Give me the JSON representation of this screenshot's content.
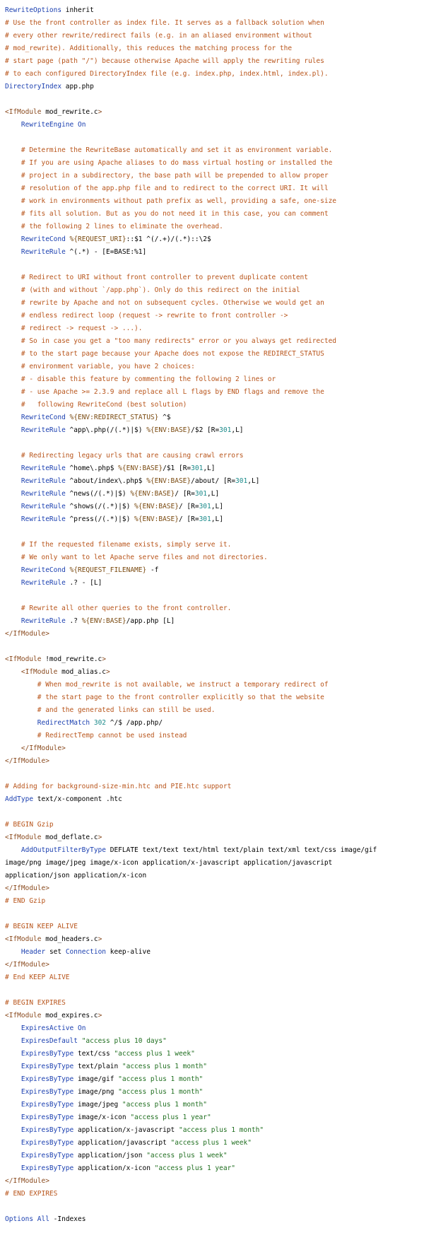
{
  "lines": [
    [
      [
        "k",
        "RewriteOptions"
      ],
      [
        "p",
        " inherit"
      ]
    ],
    [
      [
        "c",
        "# Use the front controller as index file. It serves as a fallback solution when"
      ]
    ],
    [
      [
        "c",
        "# every other rewrite/redirect fails (e.g. in an aliased environment without"
      ]
    ],
    [
      [
        "c",
        "# mod_rewrite). Additionally, this reduces the matching process for the"
      ]
    ],
    [
      [
        "c",
        "# start page (path \"/\") because otherwise Apache will apply the rewriting rules"
      ]
    ],
    [
      [
        "c",
        "# to each configured DirectoryIndex file (e.g. index.php, index.html, index.pl)."
      ]
    ],
    [
      [
        "k",
        "DirectoryIndex"
      ],
      [
        "p",
        " app.php"
      ]
    ],
    [],
    [
      [
        "t",
        "<IfModule"
      ],
      [
        "p",
        " mod_rewrite.c"
      ],
      [
        "t",
        ">"
      ]
    ],
    [
      [
        "p",
        "    "
      ],
      [
        "k",
        "RewriteEngine"
      ],
      [
        "p",
        " "
      ],
      [
        "k",
        "On"
      ]
    ],
    [],
    [
      [
        "p",
        "    "
      ],
      [
        "c",
        "# Determine the RewriteBase automatically and set it as environment variable."
      ]
    ],
    [
      [
        "p",
        "    "
      ],
      [
        "c",
        "# If you are using Apache aliases to do mass virtual hosting or installed the"
      ]
    ],
    [
      [
        "p",
        "    "
      ],
      [
        "c",
        "# project in a subdirectory, the base path will be prepended to allow proper"
      ]
    ],
    [
      [
        "p",
        "    "
      ],
      [
        "c",
        "# resolution of the app.php file and to redirect to the correct URI. It will"
      ]
    ],
    [
      [
        "p",
        "    "
      ],
      [
        "c",
        "# work in environments without path prefix as well, providing a safe, one-size"
      ]
    ],
    [
      [
        "p",
        "    "
      ],
      [
        "c",
        "# fits all solution. But as you do not need it in this case, you can comment"
      ]
    ],
    [
      [
        "p",
        "    "
      ],
      [
        "c",
        "# the following 2 lines to eliminate the overhead."
      ]
    ],
    [
      [
        "p",
        "    "
      ],
      [
        "k",
        "RewriteCond"
      ],
      [
        "p",
        " "
      ],
      [
        "v",
        "%{REQUEST_URI}"
      ],
      [
        "p",
        "::$1 ^(/.+)/(.*)::\\2$"
      ]
    ],
    [
      [
        "p",
        "    "
      ],
      [
        "k",
        "RewriteRule"
      ],
      [
        "p",
        " ^(.*) - [E=BASE:%1]"
      ]
    ],
    [],
    [
      [
        "p",
        "    "
      ],
      [
        "c",
        "# Redirect to URI without front controller to prevent duplicate content"
      ]
    ],
    [
      [
        "p",
        "    "
      ],
      [
        "c",
        "# (with and without `/app.php`). Only do this redirect on the initial"
      ]
    ],
    [
      [
        "p",
        "    "
      ],
      [
        "c",
        "# rewrite by Apache and not on subsequent cycles. Otherwise we would get an"
      ]
    ],
    [
      [
        "p",
        "    "
      ],
      [
        "c",
        "# endless redirect loop (request -> rewrite to front controller ->"
      ]
    ],
    [
      [
        "p",
        "    "
      ],
      [
        "c",
        "# redirect -> request -> ...)."
      ]
    ],
    [
      [
        "p",
        "    "
      ],
      [
        "c",
        "# So in case you get a \"too many redirects\" error or you always get redirected"
      ]
    ],
    [
      [
        "p",
        "    "
      ],
      [
        "c",
        "# to the start page because your Apache does not expose the REDIRECT_STATUS"
      ]
    ],
    [
      [
        "p",
        "    "
      ],
      [
        "c",
        "# environment variable, you have 2 choices:"
      ]
    ],
    [
      [
        "p",
        "    "
      ],
      [
        "c",
        "# - disable this feature by commenting the following 2 lines or"
      ]
    ],
    [
      [
        "p",
        "    "
      ],
      [
        "c",
        "# - use Apache >= 2.3.9 and replace all L flags by END flags and remove the"
      ]
    ],
    [
      [
        "p",
        "    "
      ],
      [
        "c",
        "#   following RewriteCond (best solution)"
      ]
    ],
    [
      [
        "p",
        "    "
      ],
      [
        "k",
        "RewriteCond"
      ],
      [
        "p",
        " "
      ],
      [
        "v",
        "%{ENV:REDIRECT_STATUS}"
      ],
      [
        "p",
        " ^$"
      ]
    ],
    [
      [
        "p",
        "    "
      ],
      [
        "k",
        "RewriteRule"
      ],
      [
        "p",
        " ^app\\.php(/(.*)|$) "
      ],
      [
        "v",
        "%{ENV:BASE}"
      ],
      [
        "p",
        "/$2 [R="
      ],
      [
        "n",
        "301"
      ],
      [
        "p",
        ",L]"
      ]
    ],
    [],
    [
      [
        "p",
        "    "
      ],
      [
        "c",
        "# Redirecting legacy urls that are causing crawl errors"
      ]
    ],
    [
      [
        "p",
        "    "
      ],
      [
        "k",
        "RewriteRule"
      ],
      [
        "p",
        " ^home\\.php$ "
      ],
      [
        "v",
        "%{ENV:BASE}"
      ],
      [
        "p",
        "/$1 [R="
      ],
      [
        "n",
        "301"
      ],
      [
        "p",
        ",L]"
      ]
    ],
    [
      [
        "p",
        "    "
      ],
      [
        "k",
        "RewriteRule"
      ],
      [
        "p",
        " ^about/index\\.php$ "
      ],
      [
        "v",
        "%{ENV:BASE}"
      ],
      [
        "p",
        "/about/ [R="
      ],
      [
        "n",
        "301"
      ],
      [
        "p",
        ",L]"
      ]
    ],
    [
      [
        "p",
        "    "
      ],
      [
        "k",
        "RewriteRule"
      ],
      [
        "p",
        " ^news(/(.*)|$) "
      ],
      [
        "v",
        "%{ENV:BASE}"
      ],
      [
        "p",
        "/ [R="
      ],
      [
        "n",
        "301"
      ],
      [
        "p",
        ",L]"
      ]
    ],
    [
      [
        "p",
        "    "
      ],
      [
        "k",
        "RewriteRule"
      ],
      [
        "p",
        " ^shows(/(.*)|$) "
      ],
      [
        "v",
        "%{ENV:BASE}"
      ],
      [
        "p",
        "/ [R="
      ],
      [
        "n",
        "301"
      ],
      [
        "p",
        ",L]"
      ]
    ],
    [
      [
        "p",
        "    "
      ],
      [
        "k",
        "RewriteRule"
      ],
      [
        "p",
        " ^press(/(.*)|$) "
      ],
      [
        "v",
        "%{ENV:BASE}"
      ],
      [
        "p",
        "/ [R="
      ],
      [
        "n",
        "301"
      ],
      [
        "p",
        ",L]"
      ]
    ],
    [],
    [
      [
        "p",
        "    "
      ],
      [
        "c",
        "# If the requested filename exists, simply serve it."
      ]
    ],
    [
      [
        "p",
        "    "
      ],
      [
        "c",
        "# We only want to let Apache serve files and not directories."
      ]
    ],
    [
      [
        "p",
        "    "
      ],
      [
        "k",
        "RewriteCond"
      ],
      [
        "p",
        " "
      ],
      [
        "v",
        "%{REQUEST_FILENAME}"
      ],
      [
        "p",
        " -f"
      ]
    ],
    [
      [
        "p",
        "    "
      ],
      [
        "k",
        "RewriteRule"
      ],
      [
        "p",
        " .? - [L]"
      ]
    ],
    [],
    [
      [
        "p",
        "    "
      ],
      [
        "c",
        "# Rewrite all other queries to the front controller."
      ]
    ],
    [
      [
        "p",
        "    "
      ],
      [
        "k",
        "RewriteRule"
      ],
      [
        "p",
        " .? "
      ],
      [
        "v",
        "%{ENV:BASE}"
      ],
      [
        "p",
        "/app.php [L]"
      ]
    ],
    [
      [
        "t",
        "</IfModule>"
      ]
    ],
    [],
    [
      [
        "t",
        "<IfModule"
      ],
      [
        "p",
        " !mod_rewrite.c"
      ],
      [
        "t",
        ">"
      ]
    ],
    [
      [
        "p",
        "    "
      ],
      [
        "t",
        "<IfModule"
      ],
      [
        "p",
        " mod_alias.c"
      ],
      [
        "t",
        ">"
      ]
    ],
    [
      [
        "p",
        "        "
      ],
      [
        "c",
        "# When mod_rewrite is not available, we instruct a temporary redirect of"
      ]
    ],
    [
      [
        "p",
        "        "
      ],
      [
        "c",
        "# the start page to the front controller explicitly so that the website"
      ]
    ],
    [
      [
        "p",
        "        "
      ],
      [
        "c",
        "# and the generated links can still be used."
      ]
    ],
    [
      [
        "p",
        "        "
      ],
      [
        "k",
        "RedirectMatch"
      ],
      [
        "p",
        " "
      ],
      [
        "n",
        "302"
      ],
      [
        "p",
        " ^/$ /app.php/"
      ]
    ],
    [
      [
        "p",
        "        "
      ],
      [
        "c",
        "# RedirectTemp cannot be used instead"
      ]
    ],
    [
      [
        "p",
        "    "
      ],
      [
        "t",
        "</IfModule>"
      ]
    ],
    [
      [
        "t",
        "</IfModule>"
      ]
    ],
    [],
    [
      [
        "c",
        "# Adding for background-size-min.htc and PIE.htc support"
      ]
    ],
    [
      [
        "k",
        "AddType"
      ],
      [
        "p",
        " text/x-component .htc"
      ]
    ],
    [],
    [
      [
        "c",
        "# BEGIN Gzip"
      ]
    ],
    [
      [
        "t",
        "<IfModule"
      ],
      [
        "p",
        " mod_deflate.c"
      ],
      [
        "t",
        ">"
      ]
    ],
    [
      [
        "p",
        "    "
      ],
      [
        "k",
        "AddOutputFilterByType"
      ],
      [
        "p",
        " DEFLATE text/text text/html text/plain text/xml text/css image/gif"
      ]
    ],
    [
      [
        "p",
        "image/png image/jpeg image/x-icon application/x-javascript application/javascript"
      ]
    ],
    [
      [
        "p",
        "application/json application/x-icon"
      ]
    ],
    [
      [
        "t",
        "</IfModule>"
      ]
    ],
    [
      [
        "c",
        "# END Gzip"
      ]
    ],
    [],
    [
      [
        "c",
        "# BEGIN KEEP ALIVE"
      ]
    ],
    [
      [
        "t",
        "<IfModule"
      ],
      [
        "p",
        " mod_headers.c"
      ],
      [
        "t",
        ">"
      ]
    ],
    [
      [
        "p",
        "    "
      ],
      [
        "k",
        "Header"
      ],
      [
        "p",
        " set "
      ],
      [
        "k",
        "Connection"
      ],
      [
        "p",
        " keep-alive"
      ]
    ],
    [
      [
        "t",
        "</IfModule>"
      ]
    ],
    [
      [
        "c",
        "# End KEEP ALIVE"
      ]
    ],
    [],
    [
      [
        "c",
        "# BEGIN EXPIRES"
      ]
    ],
    [
      [
        "t",
        "<IfModule"
      ],
      [
        "p",
        " mod_expires.c"
      ],
      [
        "t",
        ">"
      ]
    ],
    [
      [
        "p",
        "    "
      ],
      [
        "k",
        "ExpiresActive"
      ],
      [
        "p",
        " "
      ],
      [
        "k",
        "On"
      ]
    ],
    [
      [
        "p",
        "    "
      ],
      [
        "k",
        "ExpiresDefault"
      ],
      [
        "p",
        " "
      ],
      [
        "s",
        "\"access plus 10 days\""
      ]
    ],
    [
      [
        "p",
        "    "
      ],
      [
        "k",
        "ExpiresByType"
      ],
      [
        "p",
        " text/css "
      ],
      [
        "s",
        "\"access plus 1 week\""
      ]
    ],
    [
      [
        "p",
        "    "
      ],
      [
        "k",
        "ExpiresByType"
      ],
      [
        "p",
        " text/plain "
      ],
      [
        "s",
        "\"access plus 1 month\""
      ]
    ],
    [
      [
        "p",
        "    "
      ],
      [
        "k",
        "ExpiresByType"
      ],
      [
        "p",
        " image/gif "
      ],
      [
        "s",
        "\"access plus 1 month\""
      ]
    ],
    [
      [
        "p",
        "    "
      ],
      [
        "k",
        "ExpiresByType"
      ],
      [
        "p",
        " image/png "
      ],
      [
        "s",
        "\"access plus 1 month\""
      ]
    ],
    [
      [
        "p",
        "    "
      ],
      [
        "k",
        "ExpiresByType"
      ],
      [
        "p",
        " image/jpeg "
      ],
      [
        "s",
        "\"access plus 1 month\""
      ]
    ],
    [
      [
        "p",
        "    "
      ],
      [
        "k",
        "ExpiresByType"
      ],
      [
        "p",
        " image/x-icon "
      ],
      [
        "s",
        "\"access plus 1 year\""
      ]
    ],
    [
      [
        "p",
        "    "
      ],
      [
        "k",
        "ExpiresByType"
      ],
      [
        "p",
        " application/x-javascript "
      ],
      [
        "s",
        "\"access plus 1 month\""
      ]
    ],
    [
      [
        "p",
        "    "
      ],
      [
        "k",
        "ExpiresByType"
      ],
      [
        "p",
        " application/javascript "
      ],
      [
        "s",
        "\"access plus 1 week\""
      ]
    ],
    [
      [
        "p",
        "    "
      ],
      [
        "k",
        "ExpiresByType"
      ],
      [
        "p",
        " application/json "
      ],
      [
        "s",
        "\"access plus 1 week\""
      ]
    ],
    [
      [
        "p",
        "    "
      ],
      [
        "k",
        "ExpiresByType"
      ],
      [
        "p",
        " application/x-icon "
      ],
      [
        "s",
        "\"access plus 1 year\""
      ]
    ],
    [
      [
        "t",
        "</IfModule>"
      ]
    ],
    [
      [
        "c",
        "# END EXPIRES"
      ]
    ],
    [],
    [
      [
        "k",
        "Options"
      ],
      [
        "p",
        " "
      ],
      [
        "k",
        "All"
      ],
      [
        "p",
        " -Indexes"
      ]
    ]
  ],
  "colors": {
    "comment": "#b8541a",
    "keyword": "#1a3fb0",
    "tag": "#8a4a1e",
    "variable": "#7a4a10",
    "string": "#1f6e1f",
    "number": "#1a8a8a",
    "background": "#ffffff"
  }
}
